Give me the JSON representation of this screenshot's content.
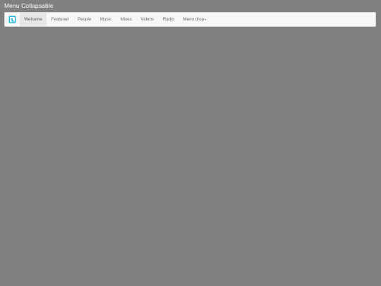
{
  "page": {
    "title": "Menu Collapsable"
  },
  "nav": {
    "logo_icon": "logo-icon",
    "items": [
      {
        "label": "Welcome",
        "active": true
      },
      {
        "label": "Featured"
      },
      {
        "label": "People"
      },
      {
        "label": "Music"
      },
      {
        "label": "Mixes"
      },
      {
        "label": "Videos"
      },
      {
        "label": "Radio"
      },
      {
        "label": "Menu drop",
        "dropdown": true
      }
    ]
  },
  "colors": {
    "background": "#808080",
    "navbar_bg": "#f7f7f7",
    "active_bg": "#e7e7e7",
    "logo_accent": "#2cb8d8"
  }
}
